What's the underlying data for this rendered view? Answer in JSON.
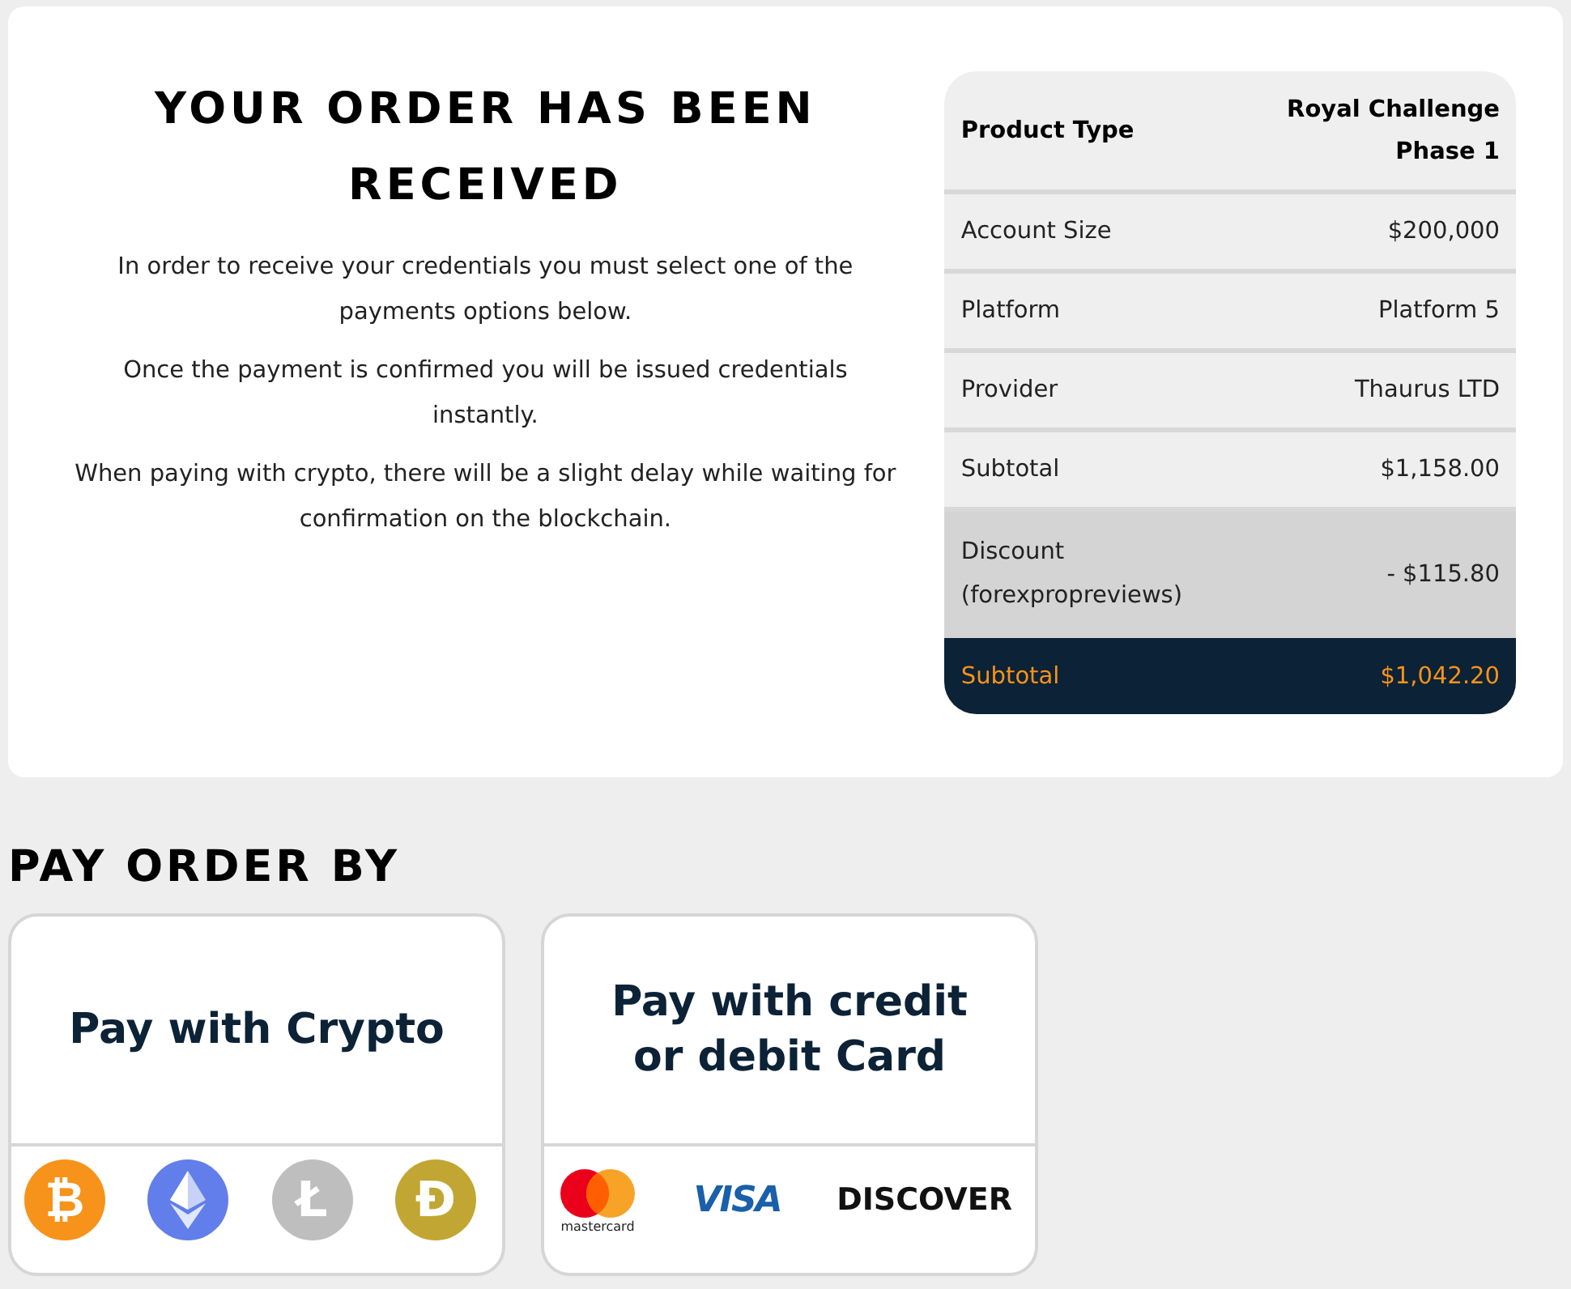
{
  "order": {
    "title": "YOUR ORDER HAS BEEN RECEIVED",
    "paragraphs": [
      "In order to receive your credentials you must select one of the payments options below.",
      "Once the payment is confirmed you will be issued credentials instantly.",
      "When paying with crypto, there will be a slight delay while waiting for confirmation on the blockchain."
    ]
  },
  "summary": {
    "rows": [
      {
        "kind": "header",
        "label": "Product Type",
        "value": "Royal Challenge Phase 1"
      },
      {
        "kind": "normal",
        "label": "Account Size",
        "value": "$200,000"
      },
      {
        "kind": "normal",
        "label": "Platform",
        "value": "Platform 5"
      },
      {
        "kind": "normal",
        "label": "Provider",
        "value": "Thaurus LTD"
      },
      {
        "kind": "normal",
        "label": "Subtotal",
        "value": "$1,158.00"
      },
      {
        "kind": "discount",
        "label": "Discount (forexpropreviews)",
        "value": "- $115.80"
      },
      {
        "kind": "total",
        "label": "Subtotal",
        "value": "$1,042.20"
      }
    ]
  },
  "payment": {
    "heading": "PAY ORDER BY",
    "options": [
      {
        "title": "Pay with Crypto",
        "logos": [
          {
            "kind": "bitcoin",
            "text": "₿"
          },
          {
            "kind": "ethereum"
          },
          {
            "kind": "litecoin",
            "text": "Ł"
          },
          {
            "kind": "dogecoin",
            "text": "Ð"
          }
        ]
      },
      {
        "title": "Pay with credit or debit Card",
        "logos": [
          {
            "kind": "mastercard",
            "text": "mastercard"
          },
          {
            "kind": "visa",
            "text": "VISA"
          },
          {
            "kind": "discover",
            "text": "DISCOVER"
          }
        ]
      }
    ]
  }
}
